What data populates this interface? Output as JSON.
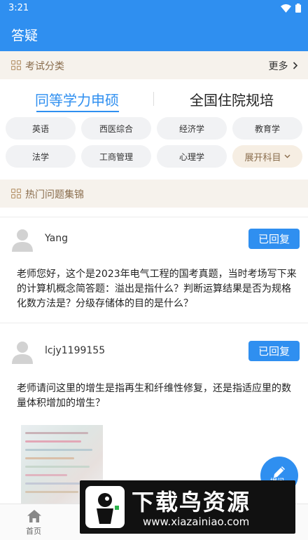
{
  "status_bar": {
    "time": "3:21"
  },
  "app_bar": {
    "title": "答疑"
  },
  "exam_section": {
    "label": "考试分类",
    "more": "更多"
  },
  "tabs": [
    {
      "label": "同等学力申硕",
      "active": true
    },
    {
      "label": "全国住院规培",
      "active": false
    }
  ],
  "subjects": [
    "英语",
    "西医综合",
    "经济学",
    "教育学",
    "法学",
    "工商管理",
    "心理学"
  ],
  "expand_label": "展开科目",
  "hot_section": {
    "label": "热门问题集锦"
  },
  "posts": [
    {
      "user": "Yang",
      "status": "已回复",
      "text": "老师您好，这个是2023年电气工程的国考真题，当时考场写下来的计算机概念简答题：溢出是指什么？判断运算结果是否为规格化数方法是？分级存储体的目的是什么？"
    },
    {
      "user": "lcjy1199155",
      "status": "已回复",
      "text": "老师请问这里的增生是指再生和纤维性修复，还是指适应里的数量体积增加的增生？"
    }
  ],
  "fab": {
    "label": "提问"
  },
  "bottom_nav": {
    "home": "首页"
  },
  "watermark": {
    "title": "下载鸟资源",
    "url": "www.xiazainiao.com"
  },
  "colors": {
    "primary": "#2f8ff0",
    "accent_brown": "#8a6d4d",
    "section_bg": "#f6f2ec"
  }
}
